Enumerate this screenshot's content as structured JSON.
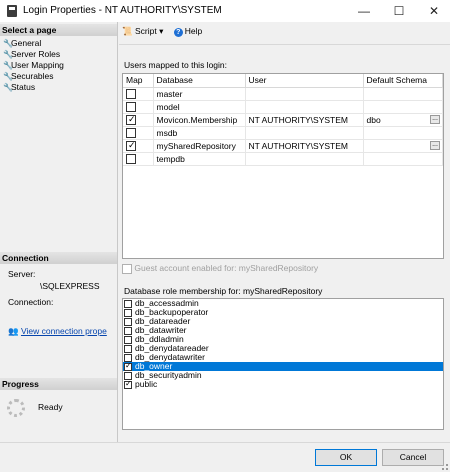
{
  "window": {
    "title": "Login Properties - NT AUTHORITY\\SYSTEM",
    "minimize": "—",
    "maximize": "☐",
    "close": "✕"
  },
  "left": {
    "select_page_header": "Select a page",
    "pages": [
      "General",
      "Server Roles",
      "User Mapping",
      "Securables",
      "Status"
    ],
    "connection_header": "Connection",
    "server_label": "Server:",
    "server_value": "\\SQLEXPRESS",
    "connection_label": "Connection:",
    "view_connection_link": "View connection prope",
    "progress_header": "Progress",
    "progress_status": "Ready"
  },
  "toolbar": {
    "script_label": "Script",
    "help_label": "Help"
  },
  "users": {
    "label": "Users mapped to this login:",
    "columns": [
      "Map",
      "Database",
      "User",
      "Default Schema"
    ],
    "rows": [
      {
        "map": false,
        "database": "master",
        "user": "",
        "schema": ""
      },
      {
        "map": false,
        "database": "model",
        "user": "",
        "schema": ""
      },
      {
        "map": true,
        "database": "Movicon.Membership",
        "user": "NT AUTHORITY\\SYSTEM",
        "schema": "dbo"
      },
      {
        "map": false,
        "database": "msdb",
        "user": "",
        "schema": ""
      },
      {
        "map": true,
        "database": "mySharedRepository",
        "user": "NT AUTHORITY\\SYSTEM",
        "schema": ""
      },
      {
        "map": false,
        "database": "tempdb",
        "user": "",
        "schema": ""
      }
    ],
    "ellipsis": "..."
  },
  "guest": {
    "label": "Guest account enabled for: mySharedRepository"
  },
  "roles": {
    "label": "Database role membership for: mySharedRepository",
    "items": [
      {
        "name": "db_accessadmin",
        "checked": false
      },
      {
        "name": "db_backupoperator",
        "checked": false
      },
      {
        "name": "db_datareader",
        "checked": false
      },
      {
        "name": "db_datawriter",
        "checked": false
      },
      {
        "name": "db_ddladmin",
        "checked": false
      },
      {
        "name": "db_denydatareader",
        "checked": false
      },
      {
        "name": "db_denydatawriter",
        "checked": false
      },
      {
        "name": "db_owner",
        "checked": true,
        "selected": true
      },
      {
        "name": "db_securityadmin",
        "checked": false
      },
      {
        "name": "public",
        "checked": true
      }
    ]
  },
  "buttons": {
    "ok": "OK",
    "cancel": "Cancel"
  },
  "colors": {
    "selection": "#0078d7",
    "link": "#0645ad"
  }
}
